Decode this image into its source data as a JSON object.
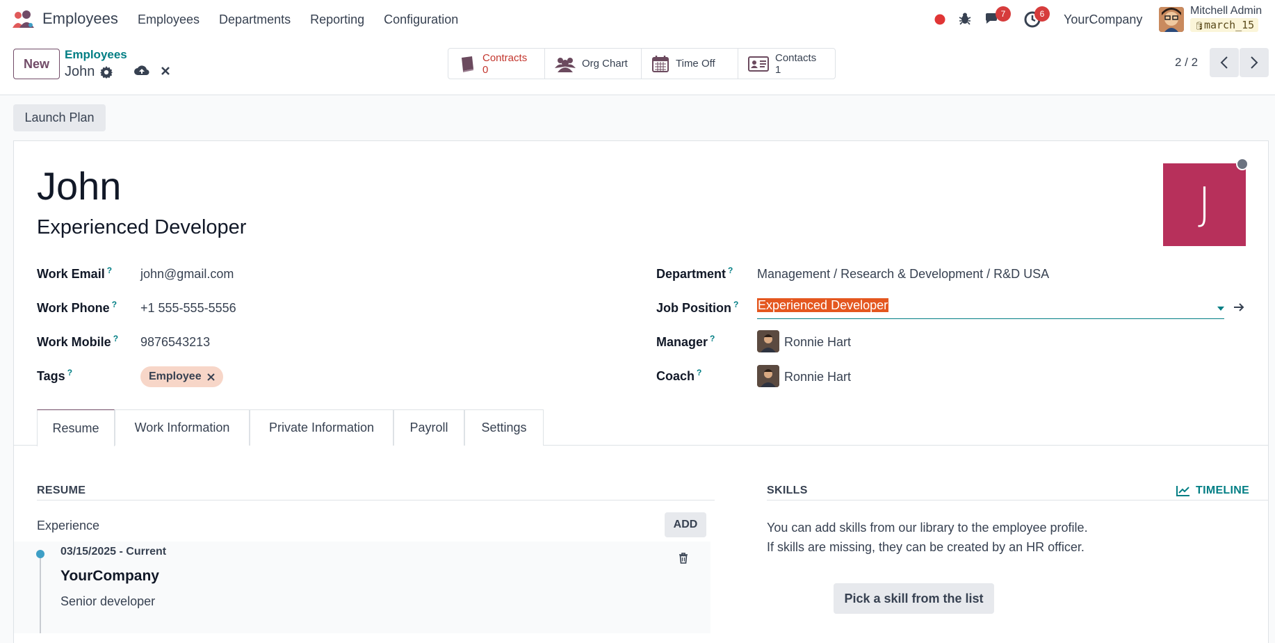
{
  "app": {
    "title": "Employees"
  },
  "menu": [
    "Employees",
    "Departments",
    "Reporting",
    "Configuration"
  ],
  "systray": {
    "messages_count": "7",
    "activities_count": "6",
    "company": "YourCompany",
    "user_name": "Mitchell Admin",
    "db_name": "march_15"
  },
  "control": {
    "new_label": "New",
    "breadcrumb_parent": "Employees",
    "breadcrumb_current": "John",
    "pager": "2 / 2"
  },
  "smart_buttons": {
    "contracts": {
      "label": "Contracts",
      "value": "0"
    },
    "org_chart": {
      "label": "Org Chart"
    },
    "time_off": {
      "label": "Time Off"
    },
    "contacts": {
      "label": "Contacts",
      "value": "1"
    }
  },
  "launch_plan_label": "Launch Plan",
  "employee": {
    "name": "John",
    "job_title": "Experienced Developer",
    "avatar_letter": "J",
    "fields": {
      "work_email_label": "Work Email",
      "work_email": "john@gmail.com",
      "work_phone_label": "Work Phone",
      "work_phone": "+1 555-555-5556",
      "work_mobile_label": "Work Mobile",
      "work_mobile": "9876543213",
      "tags_label": "Tags",
      "tag": "Employee",
      "department_label": "Department",
      "department": "Management / Research & Development / R&D USA",
      "job_position_label": "Job Position",
      "job_position": "Experienced Developer",
      "manager_label": "Manager",
      "manager": "Ronnie Hart",
      "coach_label": "Coach",
      "coach": "Ronnie Hart"
    },
    "help_mark": "?"
  },
  "tabs": [
    "Resume",
    "Work Information",
    "Private Information",
    "Payroll",
    "Settings"
  ],
  "resume": {
    "section_title": "RESUME",
    "group_title": "Experience",
    "add_label": "ADD",
    "entry": {
      "dates": "03/15/2025 - Current",
      "company": "YourCompany",
      "description": "Senior developer"
    }
  },
  "skills": {
    "section_title": "SKILLS",
    "timeline_label": "TIMELINE",
    "hint_line1": "You can add skills from our library to the employee profile.",
    "hint_line2": "If skills are missing, they can be created by an HR officer.",
    "pick_label": "Pick a skill from the list"
  },
  "colors": {
    "brand": "#714b67",
    "accent": "#017e84",
    "avatar": "#b7305b",
    "highlight": "#e4571f"
  }
}
